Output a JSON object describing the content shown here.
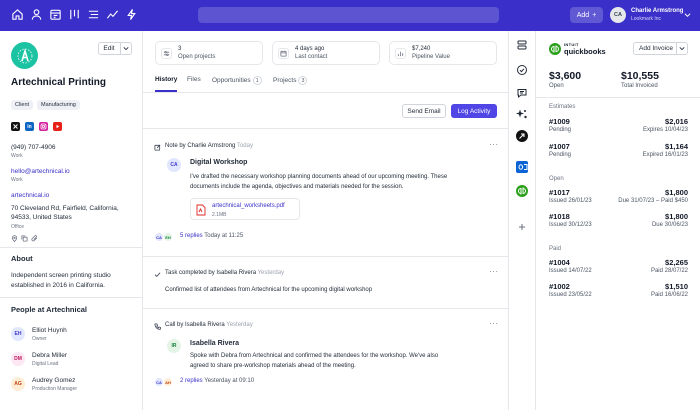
{
  "nav": {
    "icons": [
      "home-icon",
      "user-icon",
      "calendar-icon",
      "columns-icon",
      "list-icon",
      "trend-icon",
      "bolt-icon"
    ],
    "add_label": "Add",
    "user_initials": "CA",
    "user_name": "Charlie Armstrong",
    "user_org": "Lookmark Inc"
  },
  "company": {
    "name": "Artechnical Printing",
    "edit_label": "Edit",
    "tags": [
      "Client",
      "Manufacturing"
    ],
    "phone": "(949) 707-4906",
    "phone_label": "Work",
    "email": "hello@artechnical.io",
    "email_label": "Work",
    "website": "artechnical.io",
    "address_line1": "70 Cleveland Rd, Fairfield, California,",
    "address_line2": "94533, United States",
    "address_label": "Office",
    "about_heading": "About",
    "about_line1": "Independent screen printing studio",
    "about_line2": "established in 2016 in California.",
    "people_heading": "People at Artechnical",
    "people": [
      {
        "initials": "EH",
        "name": "Elliot Huynh",
        "role": "Owner",
        "color": "#e0e7ff",
        "text": "#4338ca"
      },
      {
        "initials": "DM",
        "name": "Debra Miller",
        "role": "Digital Lead",
        "color": "#fce7f3",
        "text": "#be185d"
      },
      {
        "initials": "AG",
        "name": "Audrey Gomez",
        "role": "Production Manager",
        "color": "#ffedd5",
        "text": "#c2410c"
      }
    ]
  },
  "stats": [
    {
      "value": "3",
      "label": "Open projects"
    },
    {
      "value": "4 days ago",
      "label": "Last contact"
    },
    {
      "value": "$7,240",
      "label": "Pipeline Value"
    }
  ],
  "tabs": [
    {
      "label": "History",
      "badge": ""
    },
    {
      "label": "Files",
      "badge": ""
    },
    {
      "label": "Opportunities",
      "badge": "1"
    },
    {
      "label": "Projects",
      "badge": "3"
    }
  ],
  "actions": {
    "send_email": "Send Email",
    "log_activity": "Log Activity"
  },
  "feed": [
    {
      "header": "Note by Charlie Armstrong",
      "time": "Today",
      "author_initials": "CA",
      "title": "Digital Workshop",
      "body_lines": [
        "I've drafted the necessary workshop planning documents ahead of our upcoming meeting. These",
        "documents include the agenda, objectives and materials needed for the session."
      ],
      "file_name": "artechnical_worksheets.pdf",
      "file_size": "2.1MB",
      "reply_avatars": [
        "CA",
        "EH"
      ],
      "replies": "5 replies",
      "reply_time": "Today at 11:25"
    },
    {
      "header": "Task completed by Isabella Rivera",
      "time": "Yesterday",
      "text": "Confirmed list of attendees from Artechnical for the upcoming digital workshop"
    },
    {
      "header": "Call by Isabella Rivera",
      "time": "Yesterday",
      "author_initials": "IR",
      "title": "Isabella Rivera",
      "body_lines": [
        "Spoke with Debra from Artechnical and confirmed the attendees for the workshop. We've also",
        "agreed to share pre-workshop materials ahead of the meeting."
      ],
      "reply_avatars": [
        "CA",
        "AH"
      ],
      "replies": "2 replies",
      "reply_time": "Yesterday at 09:10"
    }
  ],
  "rail": {
    "icons": [
      "stack-icon",
      "check-circle-icon",
      "chat-icon",
      "sparkle-icon",
      "arrow-circle-icon",
      "outlook-icon",
      "quickbooks-icon",
      "plus-icon"
    ]
  },
  "qb": {
    "brand_top": "INTUIT",
    "brand": "quickbooks",
    "add_invoice": "Add Invoice",
    "open_amount": "$3,600",
    "open_label": "Open",
    "total_amount": "$10,555",
    "total_label": "Total Invoiced",
    "estimates_heading": "Estimates",
    "estimates": [
      {
        "id": "#1009",
        "amount": "$2,016",
        "status": "Pending",
        "detail": "Expires 10/04/23"
      },
      {
        "id": "#1007",
        "amount": "$1,164",
        "status": "Pending",
        "detail": "Expired 16/01/23"
      }
    ],
    "open_heading": "Open",
    "open_items": [
      {
        "id": "#1017",
        "amount": "$1,800",
        "status": "Issued 26/01/23",
        "detail": "Due 31/07/23 – Paid $450"
      },
      {
        "id": "#1018",
        "amount": "$1,800",
        "status": "Issued 30/12/23",
        "detail": "Due 30/06/23"
      }
    ],
    "paid_heading": "Paid",
    "paid_items": [
      {
        "id": "#1004",
        "amount": "$2,265",
        "status": "Issued 14/07/22",
        "detail": "Paid 28/07/22"
      },
      {
        "id": "#1002",
        "amount": "$1,510",
        "status": "Issued 23/05/22",
        "detail": "Paid 16/06/22"
      }
    ]
  }
}
